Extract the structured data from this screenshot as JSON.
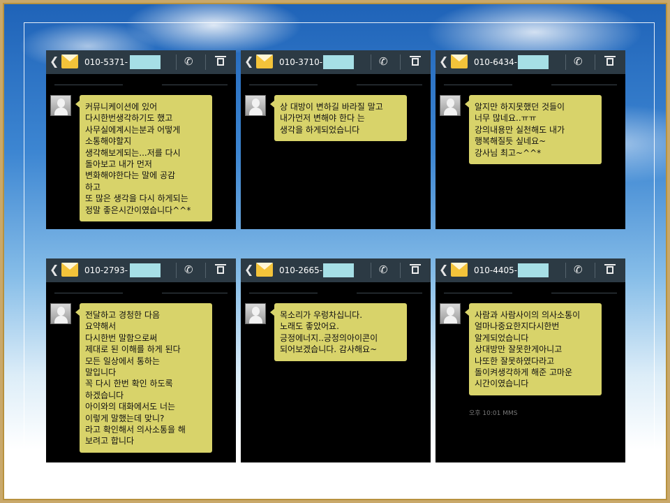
{
  "cards": [
    {
      "number": "010-5371-",
      "message": "커뮤니케이션에 있어\n다시한번생각하기도 했고\n사무실에계시는분과 어떻게\n소통해야할지\n생각해보게되는...저를 다시\n돌아보고 내가 먼저\n변화해야한다는 말에 공감\n하고\n또 많은 생각을 다시 하게되는\n정말 좋은시간이였습니다^^*"
    },
    {
      "number": "010-3710-",
      "message": "상 대방이 변하길  바라질 말고\n내가먼저 변해야 한다 는\n생각을 하게되었습니다"
    },
    {
      "number": "010-6434-",
      "message": "알지만 하지못했던 것들이\n너무 많네요..ㅠㅠ\n강의내용만 실천해도 내가\n행복해질듯 싶네요~\n강사님 최고~^^*"
    },
    {
      "number": "010-2793-",
      "message": "전달하고 경청한 다음\n요약해서\n다시한번 말함으로써\n제대로 된 이해를 하게 된다\n모든 일상에서 통하는\n말입니다\n꼭 다시 한번 확인 하도록\n하겠습니다\n아이와의 대화에서도 너는\n이렇게 말했는데 맞니?\n라고 확인해서 의사소통을 해\n보려고 합니다"
    },
    {
      "number": "010-2665-",
      "message": "목소리가 우렁차십니다.\n노래도 좋았어요.\n긍정에너지..긍정의아이콘이\n되어보겠습니다. 감사해요~"
    },
    {
      "number": "010-4405-",
      "message": "사람과 사람사이의 의사소통이\n얼마나중요한지다시한번\n알게되었습니다\n상대방만 잘못한게아니고\n나또한 잘못하였다라고\n돌이켜생각하게 해준 고마운\n시간이였습니다",
      "footer": "오후 10:01 MMS"
    }
  ],
  "icons": {
    "back": "back-chevron-icon",
    "message": "envelope-icon",
    "call": "phone-icon",
    "delete": "trash-icon"
  },
  "colors": {
    "bubble": "#d8d36a",
    "header": "#2c3a44",
    "mask": "#a6dfe6"
  }
}
